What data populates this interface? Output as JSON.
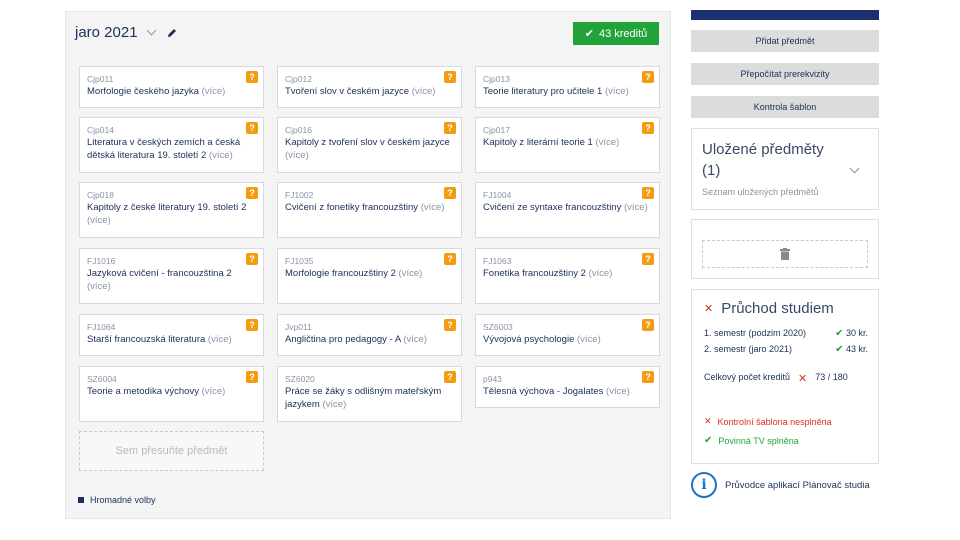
{
  "semester": {
    "title": "jaro 2021",
    "credits_label": "43 kreditů"
  },
  "courses": [
    {
      "code": "Cjp011",
      "name": "Morfologie českého jazyka",
      "more": "(více)"
    },
    {
      "code": "Cjp012",
      "name": "Tvoření slov v českém jazyce",
      "more": "(více)"
    },
    {
      "code": "Cjp013",
      "name": "Teorie literatury pro učitele 1",
      "more": "(více)"
    },
    {
      "code": "Cjp014",
      "name": "Literatura v českých zemích a česká dětská literatura 19. století 2",
      "more": "(více)"
    },
    {
      "code": "Cjp016",
      "name": "Kapitoly z tvoření slov v českém jazyce",
      "more": "(více)"
    },
    {
      "code": "Cjp017",
      "name": "Kapitoly z literární teorie 1",
      "more": "(více)"
    },
    {
      "code": "Cjp018",
      "name": "Kapitoly z české literatury 19. století 2",
      "more": "(více)"
    },
    {
      "code": "FJ1002",
      "name": "Cvičení z fonetiky francouzštiny",
      "more": "(více)"
    },
    {
      "code": "FJ1004",
      "name": "Cvičení ze syntaxe francouzštiny",
      "more": "(více)"
    },
    {
      "code": "FJ1016",
      "name": "Jazyková cvičení - francouzština 2",
      "more": "(více)"
    },
    {
      "code": "FJ1035",
      "name": "Morfologie francouzštiny 2",
      "more": "(více)"
    },
    {
      "code": "FJ1063",
      "name": "Fonetika francouzštiny 2",
      "more": "(více)"
    },
    {
      "code": "FJ1064",
      "name": "Starší francouzská literatura",
      "more": "(více)"
    },
    {
      "code": "Jvp011",
      "name": "Angličtina pro pedagogy - A",
      "more": "(více)"
    },
    {
      "code": "SZ6003",
      "name": "Vývojová psychologie",
      "more": "(více)"
    },
    {
      "code": "SZ6004",
      "name": "Teorie a metodika výchovy",
      "more": "(více)"
    },
    {
      "code": "SZ6020",
      "name": "Práce se žáky s odlišným mateřským jazykem",
      "more": "(více)"
    },
    {
      "code": "p943",
      "name": "Tělesná výchova - Jogalates",
      "more": "(více)"
    }
  ],
  "help_mark": "?",
  "drop_zone": "Sem přesuňte předmět",
  "bulk_actions": "Hromadné volby",
  "sidebar": {
    "buttons": [
      "Přidat předmět",
      "Přepočítat prerekvizity",
      "Kontrola šablon"
    ],
    "saved": {
      "title": "Uložené předměty (1)",
      "subtitle": "Seznam uložených předmětů"
    },
    "study": {
      "title": "Průchod studiem",
      "rows": [
        {
          "label": "1. semestr (podzim 2020)",
          "value": "30 kr."
        },
        {
          "label": "2. semestr (jaro 2021)",
          "value": "43 kr."
        }
      ],
      "total_label": "Celkový počet kreditů",
      "total_value": "73 / 180",
      "template_status": "Kontrolní šablona nesplněna",
      "tv_status": "Povinná TV splněna"
    },
    "guide": "Průvodce aplikací Plánovač studia"
  },
  "colors": {
    "accent": "#22a33a",
    "warning": "#f39c12",
    "danger": "#d93025",
    "navy": "#1c2f6e",
    "link": "#1a73c6"
  }
}
